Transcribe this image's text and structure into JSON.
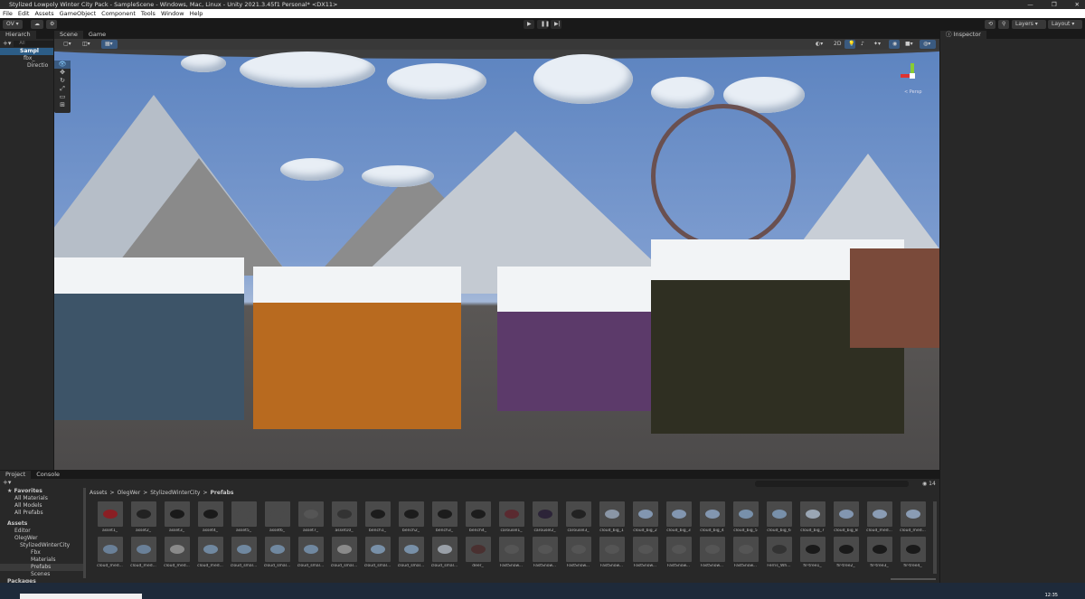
{
  "window": {
    "title": "Stylized Lowpoly Winter City Pack - SampleScene - Windows, Mac, Linux - Unity 2021.3.45f1 Personal* <DX11>",
    "controls": [
      "—",
      "❐",
      "✕"
    ]
  },
  "menu": [
    "File",
    "Edit",
    "Assets",
    "GameObject",
    "Component",
    "Tools",
    "Window",
    "Help"
  ],
  "toolbar": {
    "account": "OV ▾",
    "layers": "Layers",
    "layout": "Layout"
  },
  "hierarchy": {
    "tab": "Hierarch",
    "search_placeholder": "All",
    "items": [
      "Sampl",
      "fbx_",
      "Directio"
    ]
  },
  "scene": {
    "tabs": [
      "Scene",
      "Game"
    ],
    "mode": "2D",
    "persp": "< Persp"
  },
  "inspector": {
    "tab": "Inspector"
  },
  "project": {
    "tabs": [
      "Project",
      "Console"
    ],
    "favorites": {
      "label": "Favorites",
      "items": [
        "All Materials",
        "All Models",
        "All Prefabs"
      ]
    },
    "assets_tree": {
      "label": "Assets",
      "items": [
        "Editor",
        "OlegWer",
        "StylizedWinterCity",
        "Fbx",
        "Materials",
        "Prefabs",
        "Scenes"
      ]
    },
    "packages": "Packages",
    "breadcrumb": [
      "Assets",
      "OlegWer",
      "StylizedWinterCity",
      "Prefabs"
    ],
    "count": "14",
    "assets": [
      {
        "name": "asset1_",
        "color": "#8a1f24"
      },
      {
        "name": "asset2_",
        "color": "#222"
      },
      {
        "name": "asset3_",
        "color": "#1a1a1a"
      },
      {
        "name": "asset4_",
        "color": "#1a1a1a"
      },
      {
        "name": "asset5_",
        "color": "#4a4a4a"
      },
      {
        "name": "asset6_",
        "color": "#4a4a4a"
      },
      {
        "name": "asset7_",
        "color": "#555"
      },
      {
        "name": "asset10_",
        "color": "#333"
      },
      {
        "name": "bench1_",
        "color": "#1c1c1c"
      },
      {
        "name": "bench2_",
        "color": "#1c1c1c"
      },
      {
        "name": "bench3_",
        "color": "#1c1c1c"
      },
      {
        "name": "bench4_",
        "color": "#1c1c1c"
      },
      {
        "name": "carousel1_",
        "color": "#5a2a30"
      },
      {
        "name": "carousel2_",
        "color": "#2c2438"
      },
      {
        "name": "carousel3_",
        "color": "#222"
      },
      {
        "name": "cloud_big_1",
        "color": "#8a96a6"
      },
      {
        "name": "cloud_big_2",
        "color": "#8296b0"
      },
      {
        "name": "cloud_big_3",
        "color": "#8296b0"
      },
      {
        "name": "cloud_big_4",
        "color": "#8296b0"
      },
      {
        "name": "cloud_big_5",
        "color": "#7890aa"
      },
      {
        "name": "cloud_big_6",
        "color": "#7890aa"
      },
      {
        "name": "cloud_big_7",
        "color": "#9aa6b4"
      },
      {
        "name": "cloud_big_8",
        "color": "#8296b0"
      },
      {
        "name": "cloud_med...",
        "color": "#8a9cb4"
      },
      {
        "name": "cloud_med...",
        "color": "#8a9cb4"
      },
      {
        "name": "cloud_med...",
        "color": "#6a8098"
      },
      {
        "name": "cloud_med...",
        "color": "#6a8098"
      },
      {
        "name": "cloud_med...",
        "color": "#8a8a8a"
      },
      {
        "name": "cloud_med...",
        "color": "#7088a0"
      },
      {
        "name": "cloud_smal...",
        "color": "#7088a0"
      },
      {
        "name": "cloud_smal...",
        "color": "#7088a0"
      },
      {
        "name": "cloud_smal...",
        "color": "#7088a0"
      },
      {
        "name": "cloud_smal...",
        "color": "#8a8a8a"
      },
      {
        "name": "cloud_smal...",
        "color": "#7890a8"
      },
      {
        "name": "cloud_smal...",
        "color": "#7890a8"
      },
      {
        "name": "cloud_smal...",
        "color": "#9aa0a8"
      },
      {
        "name": "deer_",
        "color": "#4a3030"
      },
      {
        "name": "FastSnow...",
        "color": "#555"
      },
      {
        "name": "FastSnow...",
        "color": "#555"
      },
      {
        "name": "FastSnow...",
        "color": "#555"
      },
      {
        "name": "FastSnow...",
        "color": "#555"
      },
      {
        "name": "FastSnow...",
        "color": "#555"
      },
      {
        "name": "FastSnow...",
        "color": "#555"
      },
      {
        "name": "FastSnow...",
        "color": "#555"
      },
      {
        "name": "FastSnow...",
        "color": "#555"
      },
      {
        "name": "Ferris_Wh...",
        "color": "#333"
      },
      {
        "name": "fir-tree1_",
        "color": "#1a1a1a"
      },
      {
        "name": "fir-tree2_",
        "color": "#1a1a1a"
      },
      {
        "name": "fir-tree3_",
        "color": "#1a1a1a"
      },
      {
        "name": "fir-tree4_",
        "color": "#1a1a1a"
      }
    ]
  },
  "taskbar": {
    "clock": "12:35"
  }
}
